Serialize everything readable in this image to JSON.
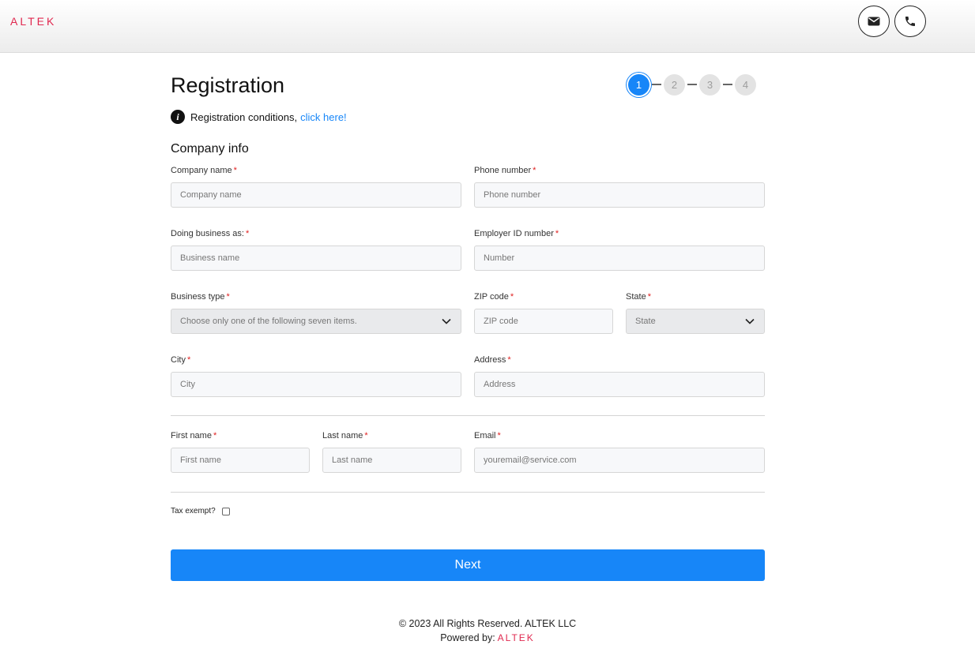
{
  "header": {
    "logo": "ALTEK",
    "mail_icon": "envelope-icon",
    "phone_icon": "phone-icon"
  },
  "page": {
    "title": "Registration",
    "steps": [
      "1",
      "2",
      "3",
      "4"
    ],
    "active_step": 1
  },
  "notice": {
    "text": "Registration conditions,",
    "link": "click here!"
  },
  "section": {
    "title": "Company info"
  },
  "fields": {
    "company_name": {
      "label": "Company name",
      "placeholder": "Company name",
      "required": "*"
    },
    "phone_number": {
      "label": "Phone number",
      "placeholder": "Phone number",
      "required": "*"
    },
    "dba": {
      "label": "Doing business as:",
      "placeholder": "Business name",
      "required": "*"
    },
    "ein": {
      "label": "Employer ID number",
      "placeholder": "Number",
      "required": "*"
    },
    "business_type": {
      "label": "Business type",
      "placeholder": "Choose only one of the following seven items.",
      "required": "*"
    },
    "zip": {
      "label": "ZIP code",
      "placeholder": "ZIP code",
      "required": "*"
    },
    "state": {
      "label": "State",
      "placeholder": "State",
      "required": "*"
    },
    "city": {
      "label": "City",
      "placeholder": "City",
      "required": "*"
    },
    "address": {
      "label": "Address",
      "placeholder": "Address",
      "required": "*"
    },
    "first_name": {
      "label": "First name",
      "placeholder": "First name",
      "required": "*"
    },
    "last_name": {
      "label": "Last name",
      "placeholder": "Last name",
      "required": "*"
    },
    "email": {
      "label": "Email",
      "placeholder": "youremail@service.com",
      "required": "*"
    }
  },
  "tax": {
    "label": "Tax exempt?",
    "checked": false
  },
  "buttons": {
    "next": "Next"
  },
  "footer": {
    "copyright": "© 2023 All Rights Reserved. ALTEK LLC",
    "powered_label": "Powered by:",
    "powered_brand": "ALTEK"
  },
  "colors": {
    "accent": "#1786f8",
    "brand": "#e0284f",
    "required": "#e02020"
  }
}
